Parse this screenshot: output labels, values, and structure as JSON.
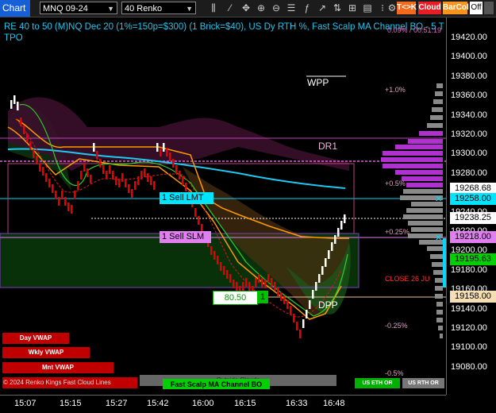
{
  "toolbar": {
    "tab": "Chart",
    "instrument": "MNQ 09-24",
    "interval": "40 Renko",
    "tk": "T<>K",
    "cloud": "Cloud",
    "barcol": "BarCol",
    "off": "Off"
  },
  "header": {
    "line1": "RE 40 to 50 (M)NQ Dec 20 (1%=150p=$300) (1 Brick=$40), US Dy RTH %, Fast Scalp MA Channel BO - 5 TH",
    "line2": "TPO",
    "overlay": "0.09% / 00:51:19"
  },
  "price_axis": [
    "19420.00",
    "19400.00",
    "19380.00",
    "19360.00",
    "19340.00",
    "19320.00",
    "19300.00",
    "19280.00",
    "19260.00",
    "19240.00",
    "19220.00",
    "19200.00",
    "19180.00",
    "19160.00",
    "19140.00",
    "19120.00",
    "19100.00",
    "19080.00"
  ],
  "price_labels": [
    {
      "text": "19268.68",
      "bg": "#ffffff",
      "fg": "#000000"
    },
    {
      "text": "19258.00",
      "bg": "#00e5ff",
      "fg": "#000000"
    },
    {
      "text": "19238.25",
      "bg": "#ffffff",
      "fg": "#000000"
    },
    {
      "text": "19218.00",
      "bg": "#e080f0",
      "fg": "#000000"
    },
    {
      "text": "19195.63",
      "bg": "#00d000",
      "fg": "#000000"
    },
    {
      "text": "19158.00",
      "bg": "#f5deb3",
      "fg": "#000000"
    }
  ],
  "time_axis": [
    "15:07",
    "15:15",
    "15:27",
    "15:42",
    "16:00",
    "16:15",
    "16:33",
    "16:48"
  ],
  "orders": {
    "sell_lmt": "1 Sell LMT",
    "sell_slm": "1 Sell SLM",
    "price_box": "80.50",
    "qty_box": "1"
  },
  "levels": {
    "wpp": "WPP",
    "dr1": "DR1",
    "dpp": "DPP",
    "close": "CLOSE 26 JU",
    "pct_p1": "+1.0%",
    "pct_p05": "+0.5%",
    "pct_p025": "+0.25%",
    "pct_m025": "-0.25%",
    "pct_m05": "-0.5%"
  },
  "buttons": {
    "day_vwap": "Day VWAP",
    "wkly_vwap": "Wkly VWAP",
    "mnt_vwap": "Mnt VWAP",
    "fast_scalp": "Fast Scalp MA Channel BO",
    "outside_clouds": "Outside Clouds",
    "us_eth": "US ETH OR",
    "us_rth": "US RTH OR",
    "copyright": "© 2024 Renko Kings Fast Cloud Lines"
  },
  "colors": {
    "up": "#ffffff",
    "down": "#e60000",
    "ma_slow": "#1ec8f0",
    "ma_fast": "#ff9a00",
    "cloud_green": "#0f3a12",
    "cloud_purple": "#3a1030",
    "tpo": "#8a8a8a",
    "tpo_hi": "#b030d0"
  }
}
